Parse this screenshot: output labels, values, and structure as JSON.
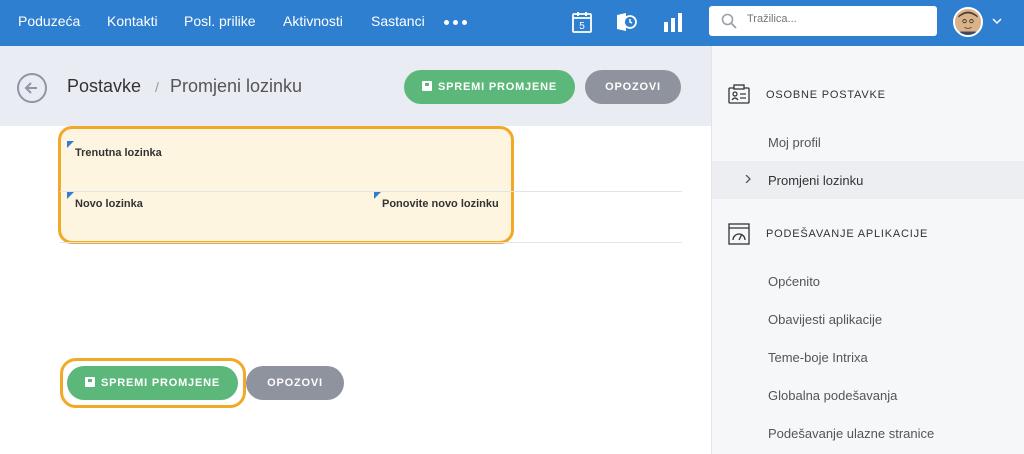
{
  "topnav": {
    "items": [
      "Poduzeća",
      "Kontakti",
      "Posl. prilike",
      "Aktivnosti",
      "Sastanci"
    ],
    "calendar_day": "5",
    "search_placeholder": "Tražilica..."
  },
  "header": {
    "breadcrumb_root": "Postavke",
    "separator": "/",
    "page_title": "Promjeni lozinku",
    "save_label": "SPREMI PROMJENE",
    "cancel_label": "OPOZOVI"
  },
  "form": {
    "current_password_label": "Trenutna lozinka",
    "new_password_label": "Novo lozinka",
    "repeat_password_label": "Ponovite novo lozinku",
    "save_label": "SPREMI PROMJENE",
    "cancel_label": "OPOZOVI"
  },
  "sidebar": {
    "section_personal": "OSOBNE POSTAVKE",
    "personal_items": [
      "Moj profil",
      "Promjeni lozinku"
    ],
    "section_app": "PODEŠAVANJE APLIKACIJE",
    "app_items": [
      "Općenito",
      "Obavijesti aplikacije",
      "Teme-boje Intrixa",
      "Globalna podešavanja",
      "Podešavanje ulazne stranice"
    ]
  },
  "colors": {
    "accent": "#2f7fd0",
    "save_green": "#5cb87a",
    "cancel_grey": "#8f939e",
    "highlight": "#f2a928"
  },
  "icons": [
    "search-icon",
    "calendar-icon",
    "activity-clock-icon",
    "bar-chart-icon",
    "chevron-down-icon",
    "back-arrow-icon",
    "save-icon",
    "id-card-icon",
    "gauge-window-icon",
    "chevron-right-icon"
  ]
}
